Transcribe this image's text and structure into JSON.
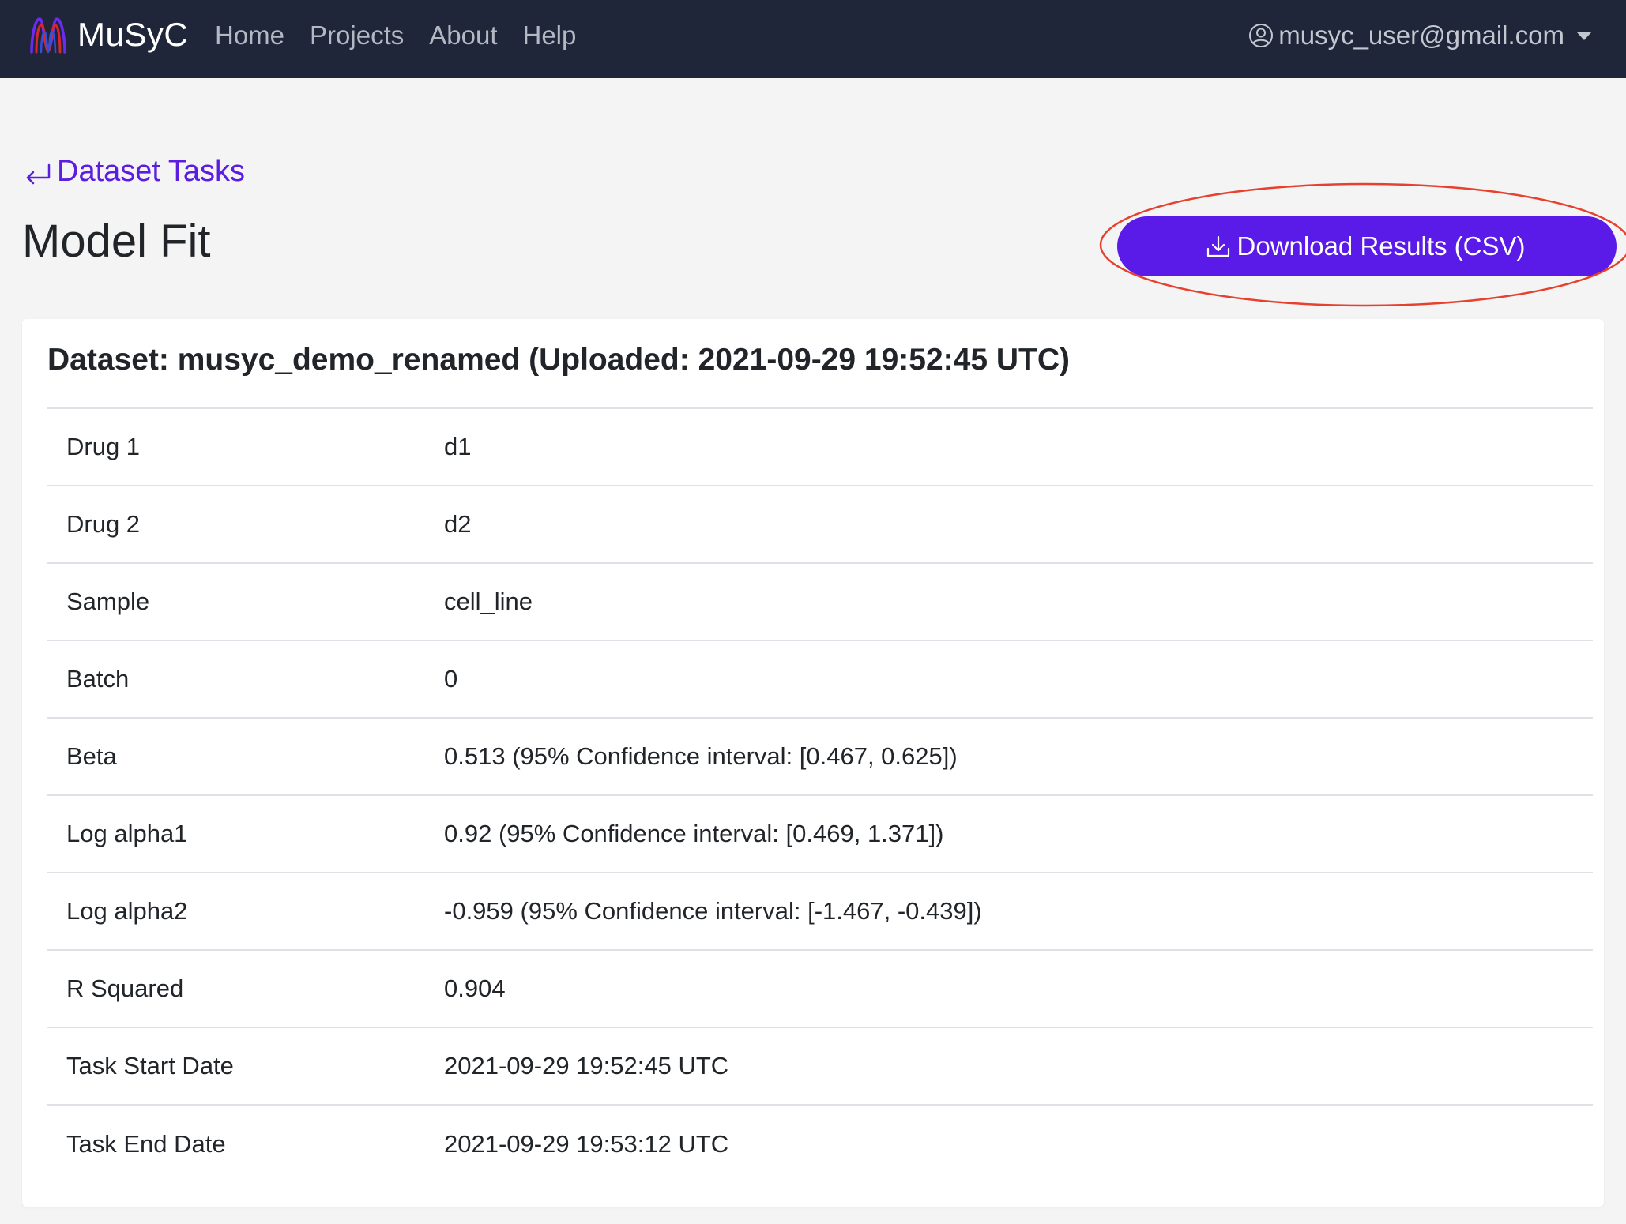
{
  "navbar": {
    "brand": "MuSyC",
    "links": [
      "Home",
      "Projects",
      "About",
      "Help"
    ],
    "user_email": "musyc_user@gmail.com"
  },
  "back_link": {
    "label": "Dataset Tasks"
  },
  "page": {
    "title": "Model Fit",
    "download_label": "Download Results (CSV)"
  },
  "card": {
    "title": "Dataset: musyc_demo_renamed (Uploaded: 2021-09-29 19:52:45 UTC)",
    "rows": [
      {
        "label": "Drug 1",
        "value": "d1"
      },
      {
        "label": "Drug 2",
        "value": "d2"
      },
      {
        "label": "Sample",
        "value": "cell_line"
      },
      {
        "label": "Batch",
        "value": "0"
      },
      {
        "label": "Beta",
        "value": "0.513 (95% Confidence interval: [0.467, 0.625])"
      },
      {
        "label": "Log alpha1",
        "value": "0.92 (95% Confidence interval: [0.469, 1.371])"
      },
      {
        "label": "Log alpha2",
        "value": "-0.959 (95% Confidence interval: [-1.467, -0.439])"
      },
      {
        "label": "R Squared",
        "value": "0.904"
      },
      {
        "label": "Task Start Date",
        "value": "2021-09-29 19:52:45 UTC"
      },
      {
        "label": "Task End Date",
        "value": "2021-09-29 19:53:12 UTC"
      }
    ]
  },
  "colors": {
    "navbar_bg": "#1f2639",
    "accent": "#5a1be8",
    "link": "#5b1ee0",
    "highlight_ring": "#e8402e"
  },
  "icons": {
    "brand": "musyc-logo-icon",
    "user": "user-circle-icon",
    "back": "return-arrow-icon",
    "download": "download-icon"
  }
}
